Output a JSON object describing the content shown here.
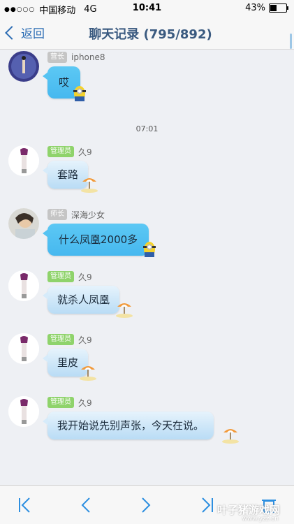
{
  "status_bar": {
    "signal": "●●○○○",
    "carrier": "中国移动",
    "network": "4G",
    "time": "10:41",
    "battery_percent": "43%",
    "battery_level": 0.43
  },
  "nav": {
    "back_label": "返回",
    "title": "聊天记录 (795/892)"
  },
  "messages": [
    {
      "role": "营长",
      "sender": "iphone8",
      "text": "哎",
      "style": "blue",
      "decor": "minion-icon"
    },
    {
      "role": "管理员",
      "sender": "久9",
      "text": "套路",
      "style": "light",
      "decor": "parasol-icon"
    },
    {
      "role": "师长",
      "sender": "深海少女",
      "text": "什么凤凰2000多",
      "style": "blue",
      "decor": "minion-icon"
    },
    {
      "role": "管理员",
      "sender": "久9",
      "text": "就杀人凤凰",
      "style": "light",
      "decor": "parasol-icon"
    },
    {
      "role": "管理员",
      "sender": "久9",
      "text": "里皮",
      "style": "light",
      "decor": "parasol-icon"
    },
    {
      "role": "管理员",
      "sender": "久9",
      "text": "我开始说先别声张，今天在说。",
      "style": "light",
      "decor": "parasol-icon"
    }
  ],
  "timestamp": "07:01",
  "watermark": {
    "text": "叶子猪游戏网",
    "url": "www.yzz.cn"
  },
  "colors": {
    "accent": "#2d6db4",
    "bubble_blue": "#4fc0f2",
    "bubble_light": "#cfe6f8",
    "badge_green": "#8fd36b"
  }
}
